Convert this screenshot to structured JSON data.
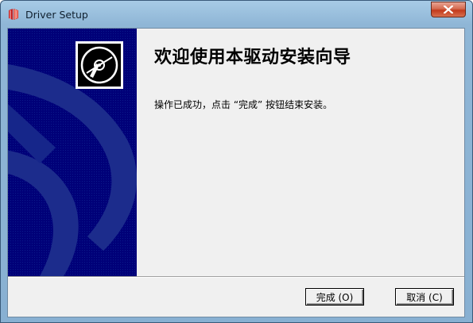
{
  "window": {
    "title": "Driver Setup",
    "close_icon": "close-icon"
  },
  "wizard": {
    "heading": "欢迎使用本驱动安装向导",
    "message": "操作已成功，点击 “完成” 按钮结束安装。"
  },
  "buttons": {
    "finish_label": "完成 (O)",
    "cancel_label": "取消 (C)"
  },
  "colors": {
    "banner": "#000078",
    "banner_art": "#1c2c8c",
    "close_button": "#c8452a",
    "dialog_bg": "#f0f0f0"
  }
}
